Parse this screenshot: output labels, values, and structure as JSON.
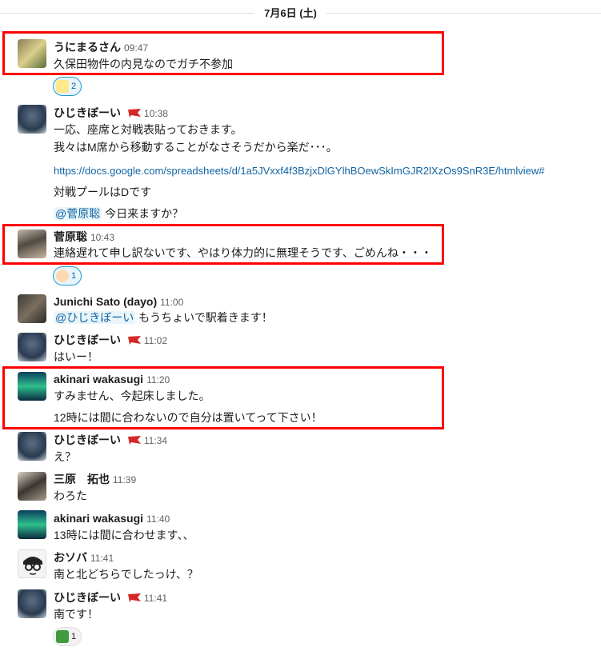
{
  "date_divider": "7月6日 (土)",
  "messages": [
    {
      "name": "うにまるさん",
      "time": "09:47",
      "lines": [
        "久保田物件の内見なのでガチ不参加"
      ],
      "reaction": "2"
    },
    {
      "name": "ひじきぼーい",
      "time": "10:38",
      "lines": [
        "一応、座席と対戦表貼っておきます。",
        "我々はM席から移動することがなさそうだから楽だ･･･。"
      ],
      "link": "https://docs.google.com/spreadsheets/d/1a5JVxxf4f3BzjxDlGYlhBOewSkImGJR2lXzOs9SnR3E/htmlview#",
      "pool": "対戦プールはDです",
      "mention": "@菅原聡",
      "after_mention": " 今日来ますか？"
    },
    {
      "name": "菅原聡",
      "time": "10:43",
      "lines": [
        "連絡遅れて申し訳ないです、やはり体力的に無理そうです、ごめんね・・・"
      ],
      "reaction": "1"
    },
    {
      "name": "Junichi Sato (dayo)",
      "time": "11:00",
      "mention": "@ひじきぼーい",
      "after_mention": " もうちょいで駅着きます！"
    },
    {
      "name": "ひじきぼーい",
      "time": "11:02",
      "lines": [
        "はいー！"
      ]
    },
    {
      "name": "akinari wakasugi",
      "time": "11:20",
      "lines": [
        "すみません、今起床しました。",
        "12時には間に合わないので自分は置いてって下さい！"
      ]
    },
    {
      "name": "ひじきぼーい",
      "time": "11:34",
      "lines": [
        "え？"
      ]
    },
    {
      "name": "三原　拓也",
      "time": "11:39",
      "lines": [
        "わろた"
      ]
    },
    {
      "name": "akinari wakasugi",
      "time": "11:40",
      "lines": [
        "13時には間に合わせます、、"
      ]
    },
    {
      "name": "おソバ",
      "time": "11:41",
      "lines": [
        "南と北どちらでしたっけ、？"
      ]
    },
    {
      "name": "ひじきぼーい",
      "time": "11:41",
      "lines": [
        "南です！"
      ],
      "reaction": "1"
    }
  ],
  "colors": {
    "highlight": "#ff0000",
    "link": "#1264a3",
    "mention_bg": "#e8f5fa"
  }
}
